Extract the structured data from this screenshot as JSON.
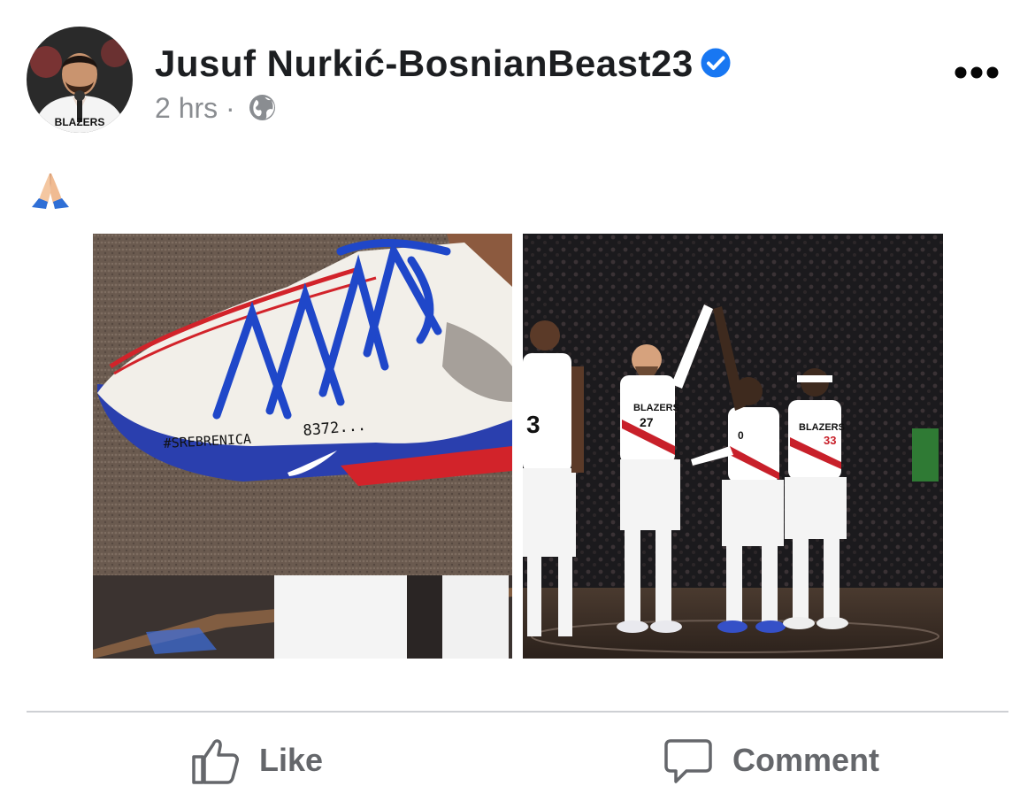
{
  "post": {
    "author": "Jusuf Nurkić-BosnianBeast23",
    "verified": true,
    "time": "2 hrs",
    "separator": "·",
    "audience_icon": "globe-icon",
    "body_emoji": "🙏",
    "menu_icon": "more-horizontal-icon"
  },
  "media": {
    "left_image": {
      "shoe_text_hashtag": "#SREBRENICA",
      "shoe_text_number": "8372..."
    },
    "right_image": {
      "jersey_text": "BLAZERS",
      "jersey_numbers": [
        "3",
        "27",
        "0",
        "33"
      ]
    }
  },
  "actions": {
    "like_label": "Like",
    "like_icon": "thumbs-up-icon",
    "comment_label": "Comment",
    "comment_icon": "comment-bubble-icon"
  },
  "colors": {
    "author_text": "#1c1e21",
    "meta_text": "#8a8d91",
    "verified_blue": "#1877f2",
    "action_gray": "#65676b",
    "divider": "#ced0d4"
  }
}
